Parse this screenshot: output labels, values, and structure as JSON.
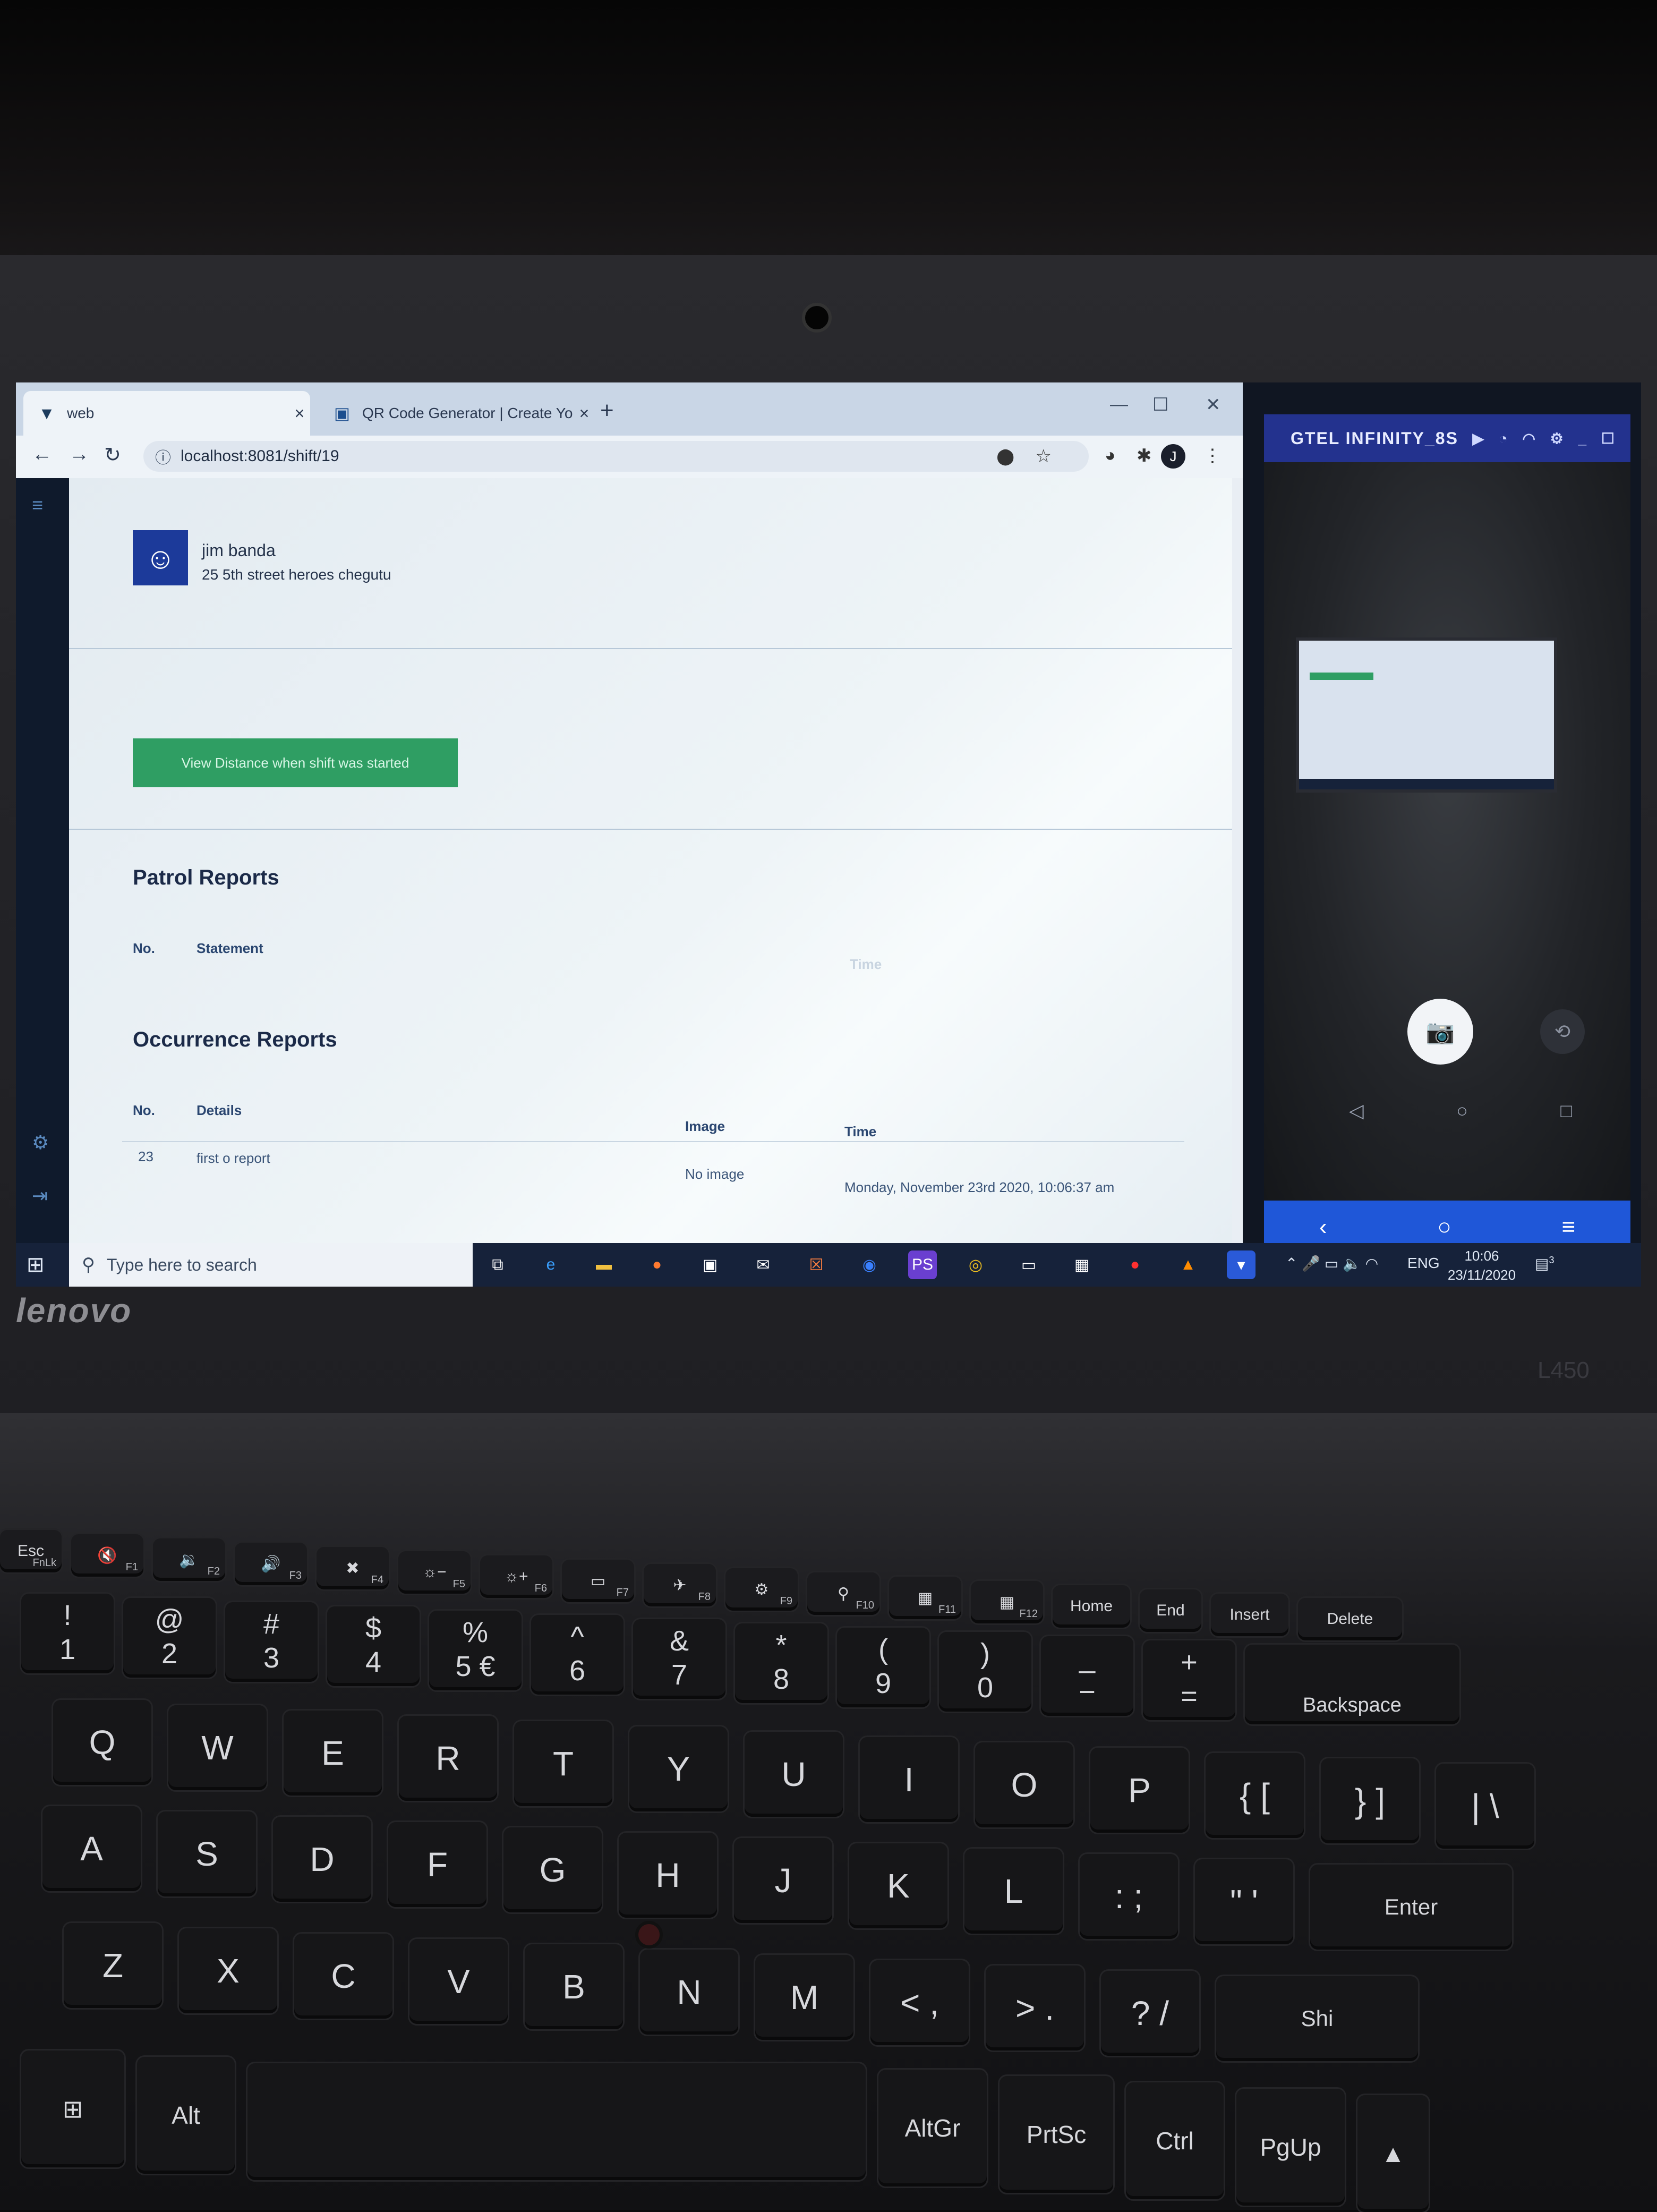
{
  "browser": {
    "tabs": [
      {
        "title": "web",
        "icon": "vue-logo-icon"
      },
      {
        "title": "QR Code Generator | Create Your",
        "icon": "qr-code-icon"
      }
    ],
    "url": "localhost:8081/shift/19",
    "profile_initial": "J"
  },
  "page": {
    "person": {
      "name": "jim banda",
      "address": "25 5th street heroes chegutu"
    },
    "distance_button": "View Distance when shift was started",
    "patrol": {
      "title": "Patrol Reports",
      "columns": [
        "No.",
        "Statement",
        "Time"
      ]
    },
    "occurrence": {
      "title": "Occurrence Reports",
      "columns": [
        "No.",
        "Details",
        "Image",
        "Time"
      ],
      "rows": [
        {
          "no": "23",
          "details": "first o report",
          "image": "No image",
          "time": "Monday, November 23rd 2020, 10:06:37 am"
        }
      ]
    }
  },
  "taskbar": {
    "search_placeholder": "Type here to search",
    "language": "ENG",
    "time": "10:06",
    "date": "23/11/2020",
    "notifications": "3"
  },
  "phone_window": {
    "title": "GTEL INFINITY_8S"
  },
  "laptop": {
    "brand": "lenovo",
    "model": "L450"
  },
  "keyboard": {
    "fn_row": [
      {
        "main": "Esc",
        "sub": "FnLk"
      },
      {
        "main": "🔇",
        "sub": "F1"
      },
      {
        "main": "🔉",
        "sub": "F2"
      },
      {
        "main": "🔊",
        "sub": "F3"
      },
      {
        "main": "✖",
        "sub": "F4"
      },
      {
        "main": "☼−",
        "sub": "F5"
      },
      {
        "main": "☼+",
        "sub": "F6"
      },
      {
        "main": "▭",
        "sub": "F7"
      },
      {
        "main": "✈",
        "sub": "F8"
      },
      {
        "main": "⚙",
        "sub": "F9"
      },
      {
        "main": "⚲",
        "sub": "F10"
      },
      {
        "main": "▦",
        "sub": "F11"
      },
      {
        "main": "▦",
        "sub": "F12"
      },
      {
        "main": "Home",
        "sub": ""
      },
      {
        "main": "End",
        "sub": ""
      },
      {
        "main": "Insert",
        "sub": ""
      },
      {
        "main": "Delete",
        "sub": ""
      }
    ],
    "number_row": [
      {
        "top": "!",
        "bot": "1"
      },
      {
        "top": "@",
        "bot": "2"
      },
      {
        "top": "#",
        "bot": "3"
      },
      {
        "top": "$",
        "bot": "4"
      },
      {
        "top": "%",
        "bot": "5 €"
      },
      {
        "top": "^",
        "bot": "6"
      },
      {
        "top": "&",
        "bot": "7"
      },
      {
        "top": "*",
        "bot": "8"
      },
      {
        "top": "(",
        "bot": "9"
      },
      {
        "top": ")",
        "bot": "0"
      },
      {
        "top": "_",
        "bot": "−"
      },
      {
        "top": "+",
        "bot": "="
      },
      {
        "top": "",
        "bot": "Backspace"
      }
    ],
    "row_q": [
      "Q",
      "W",
      "E",
      "R",
      "T",
      "Y",
      "U",
      "I",
      "O",
      "P",
      "{ [",
      "} ]",
      "| \\"
    ],
    "row_a": [
      "A",
      "S",
      "D",
      "F",
      "G",
      "H",
      "J",
      "K",
      "L",
      ": ;",
      "\" '",
      "Enter"
    ],
    "row_z": [
      "Z",
      "X",
      "C",
      "V",
      "B",
      "N",
      "M",
      "< ,",
      "> .",
      "? /",
      "Shi"
    ],
    "bottom_row": [
      "⊞",
      "Alt",
      "",
      "AltGr",
      "PrtSc",
      "Ctrl",
      "PgUp",
      "▲"
    ]
  }
}
